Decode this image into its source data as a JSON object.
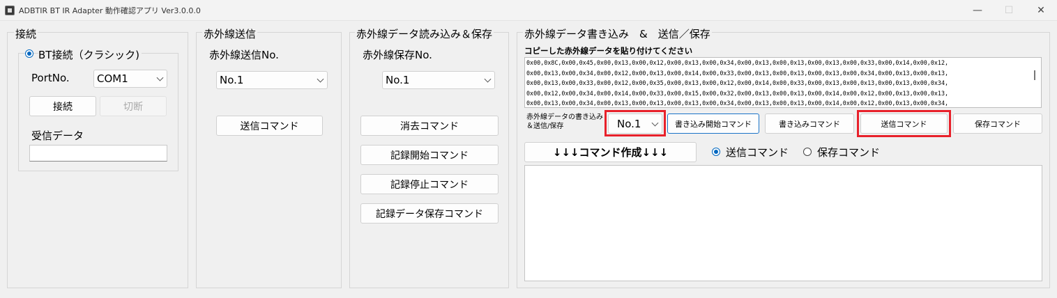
{
  "window": {
    "title": "ADBTIR BT IR Adapter 動作確認アプリ Ver3.0.0.0",
    "minimize": "—",
    "maximize": "☐",
    "close": "✕"
  },
  "connection": {
    "group_title": "接続",
    "radio_label": "BT接続（クラシック)",
    "port_label": "PortNo.",
    "port_value": "COM1",
    "connect_button": "接続",
    "disconnect_button": "切断",
    "receive_label": "受信データ",
    "receive_value": ""
  },
  "ir_send": {
    "group_title": "赤外線送信",
    "no_label": "赤外線送信No.",
    "no_value": "No.1",
    "send_button": "送信コマンド"
  },
  "ir_read": {
    "group_title": "赤外線データ読み込み＆保存",
    "no_label": "赤外線保存No.",
    "no_value": "No.1",
    "erase_button": "消去コマンド",
    "record_start_button": "記録開始コマンド",
    "record_stop_button": "記録停止コマンド",
    "record_save_button": "記録データ保存コマンド"
  },
  "ir_write": {
    "group_title": "赤外線データ書き込み　&　送信／保存",
    "paste_label": "コピーした赤外線データを貼り付けてください",
    "hex_lines": [
      "0x00,0x8C,0x00,0x45,0x00,0x13,0x00,0x12,0x00,0x13,0x00,0x34,0x00,0x13,0x00,0x13,0x00,0x13,0x00,0x33,0x00,0x14,0x00,0x12,",
      "0x00,0x13,0x00,0x34,0x00,0x12,0x00,0x13,0x00,0x14,0x00,0x33,0x00,0x13,0x00,0x13,0x00,0x13,0x00,0x34,0x00,0x13,0x00,0x13,",
      "0x00,0x13,0x00,0x33,0x00,0x12,0x00,0x35,0x00,0x13,0x00,0x12,0x00,0x14,0x00,0x33,0x00,0x13,0x00,0x13,0x00,0x13,0x00,0x34,",
      "0x00,0x12,0x00,0x34,0x00,0x14,0x00,0x33,0x00,0x15,0x00,0x32,0x00,0x13,0x00,0x13,0x00,0x14,0x00,0x12,0x00,0x13,0x00,0x13,",
      "0x00,0x13,0x00,0x34,0x00,0x13,0x00,0x13,0x00,0x13,0x00,0x34,0x00,0x13,0x00,0x13,0x00,0x14,0x00,0x12,0x00,0x13,0x00,0x34,"
    ],
    "write_label_line1": "赤外線データの書き込み",
    "write_label_line2": "＆送信/保存",
    "no_value": "No.1",
    "write_start_button": "書き込み開始コマンド",
    "write_button": "書き込みコマンド",
    "send_button": "送信コマンド",
    "save_button": "保存コマンド",
    "make_command_button": "↓↓↓コマンド作成↓↓↓",
    "radio_send_label": "送信コマンド",
    "radio_save_label": "保存コマンド",
    "output_value": ""
  },
  "highlight_color": "#e8212b",
  "accent_color": "#0067c0"
}
